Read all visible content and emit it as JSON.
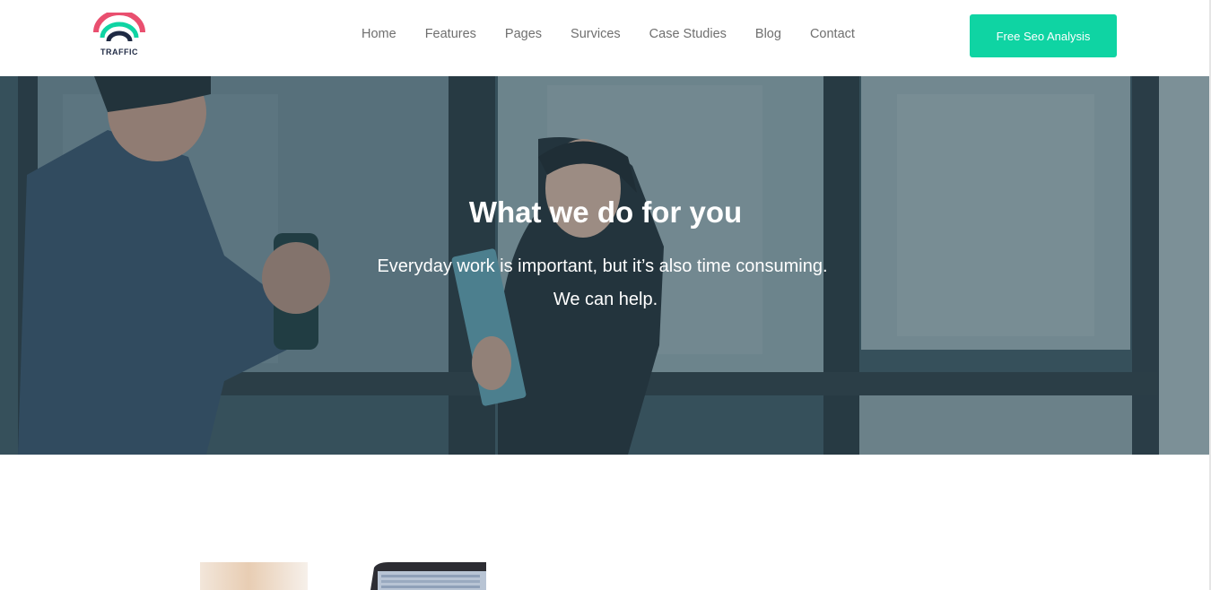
{
  "brand": {
    "logo_text": "TRAFFIC",
    "colors": {
      "arc_outer": "#e94f6f",
      "arc_middle": "#0fd4a3",
      "arc_inner": "#1f2a44"
    }
  },
  "nav": {
    "items": [
      {
        "label": "Home"
      },
      {
        "label": "Features"
      },
      {
        "label": "Pages"
      },
      {
        "label": "Survices"
      },
      {
        "label": "Case Studies"
      },
      {
        "label": "Blog"
      },
      {
        "label": "Contact"
      }
    ]
  },
  "header": {
    "cta_label": "Free Seo Analysis",
    "cta_color": "#0fd4a3"
  },
  "hero": {
    "title": "What we do for you",
    "line1": "Everyday work is important, but it’s also time consuming.",
    "line2": "We can help.",
    "overlay_color": "#3b5460"
  }
}
